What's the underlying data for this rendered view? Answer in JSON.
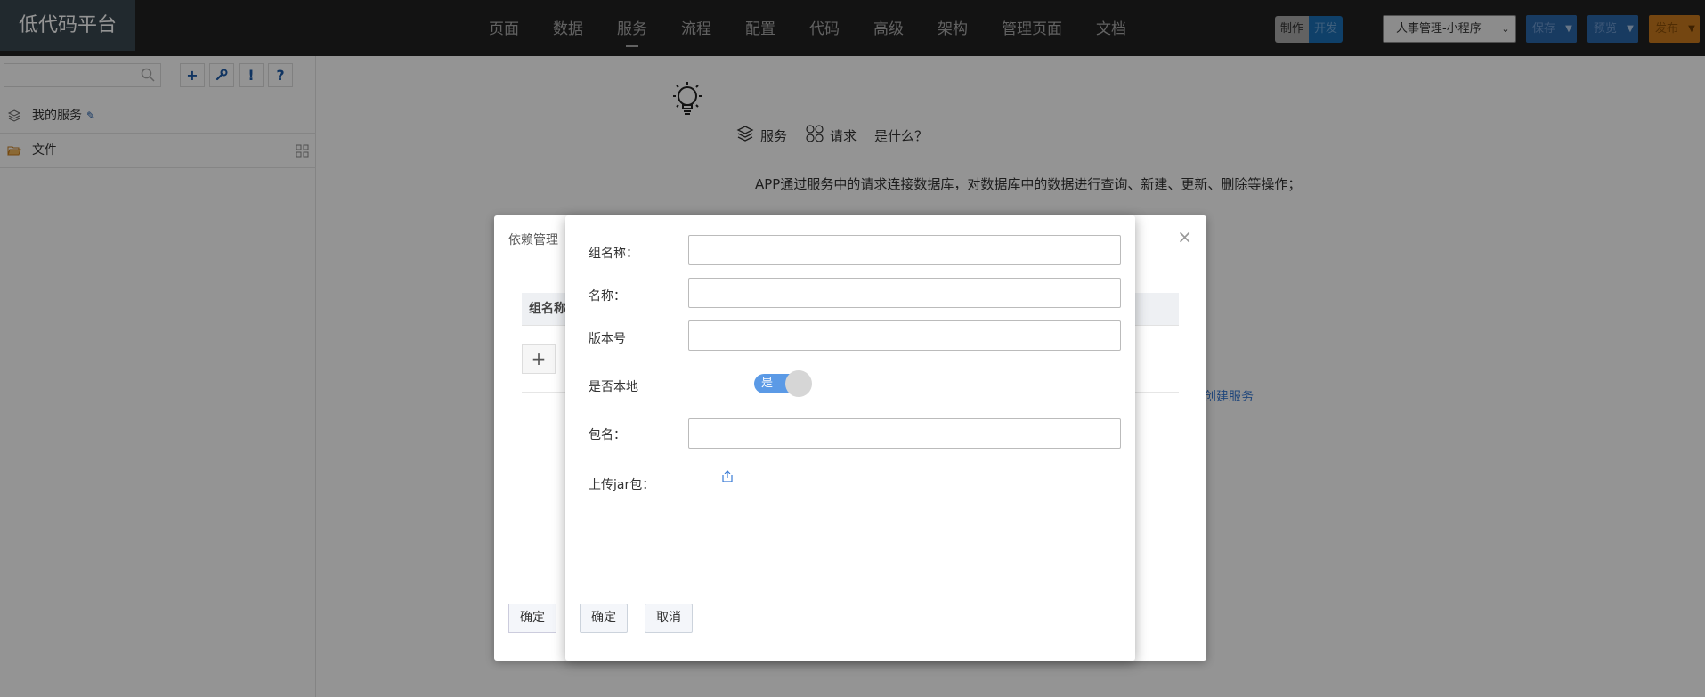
{
  "app": {
    "brand": "低代码平台"
  },
  "nav": {
    "items": [
      "页面",
      "数据",
      "服务",
      "流程",
      "配置",
      "代码",
      "高级",
      "架构",
      "管理页面",
      "文档"
    ],
    "active": "服务"
  },
  "header": {
    "mode_make": "制作",
    "mode_dev": "开发",
    "project_select": "人事管理-小程序",
    "save": "保存",
    "preview": "预览",
    "publish": "发布"
  },
  "sidebar": {
    "search_placeholder": "",
    "tools": [
      "+",
      "wrench-icon",
      "!",
      "?"
    ],
    "rows": [
      {
        "label": "我的服务",
        "icon": "layers-icon"
      },
      {
        "label": "文件",
        "icon": "folder-open-icon"
      }
    ]
  },
  "intro": {
    "tabs": [
      {
        "label": "服务",
        "icon": "layers-icon"
      },
      {
        "label": "请求",
        "icon": "grid-circles-icon"
      },
      {
        "label": "是什么？",
        "icon": ""
      }
    ],
    "description": "APP通过服务中的请求连接数据库，对数据库中的数据进行查询、新建、更新、删除等操作；",
    "create_link": "创建服务"
  },
  "dependency_dialog": {
    "title": "依赖管理",
    "column_header": "组名称",
    "add": "+",
    "ok": "确定"
  },
  "form_dialog": {
    "fields": [
      {
        "label": "组名称：",
        "value": "",
        "placeholder": ""
      },
      {
        "label": "名称：",
        "value": "",
        "placeholder": ""
      },
      {
        "label": "版本号",
        "value": "",
        "placeholder": ""
      }
    ],
    "local_label": "是否本地",
    "local_toggle_text": "是",
    "local_toggle_on": true,
    "package_label": "包名：",
    "package_value": "",
    "upload_label": "上传jar包：",
    "ok": "确定",
    "cancel": "取消"
  },
  "colors": {
    "topbar": "#222222",
    "accent_blue": "#2a67a8",
    "accent_orange": "#c9791e",
    "toggle": "#5b9ae6"
  }
}
